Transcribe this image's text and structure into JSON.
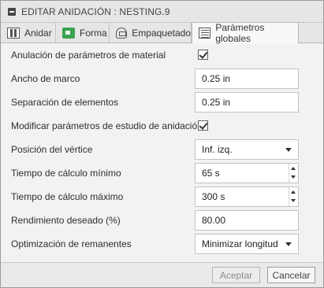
{
  "dialog": {
    "title": "EDITAR ANIDACIÓN : NESTING.9"
  },
  "tabs": [
    {
      "label": "Anidar",
      "icon": "nest-icon"
    },
    {
      "label": "Forma",
      "icon": "shape-icon"
    },
    {
      "label": "Empaquetado",
      "icon": "packing-icon"
    },
    {
      "label": "Parámetros globales",
      "icon": "parameters-icon",
      "active": true
    }
  ],
  "form": {
    "material_override": {
      "label": "Anulación de parámetros de material",
      "checked": true
    },
    "frame_width": {
      "label": "Ancho de marco",
      "value": "0.25 in"
    },
    "part_separation": {
      "label": "Separación de elementos",
      "value": "0.25 in"
    },
    "modify_study": {
      "label": "Modificar parámetros de estudio de anidación",
      "checked": true
    },
    "vertex_position": {
      "label": "Posición del vértice",
      "value": "Inf. izq."
    },
    "min_time": {
      "label": "Tiempo de cálculo mínimo",
      "value": "65 s"
    },
    "max_time": {
      "label": "Tiempo de cálculo máximo",
      "value": "300 s"
    },
    "target_efficiency": {
      "label": "Rendimiento deseado (%)",
      "value": "80.00"
    },
    "remnant_optimization": {
      "label": "Optimización de remanentes",
      "value": "Minimizar longitud"
    }
  },
  "footer": {
    "ok_label": "Aceptar",
    "cancel_label": "Cancelar"
  }
}
